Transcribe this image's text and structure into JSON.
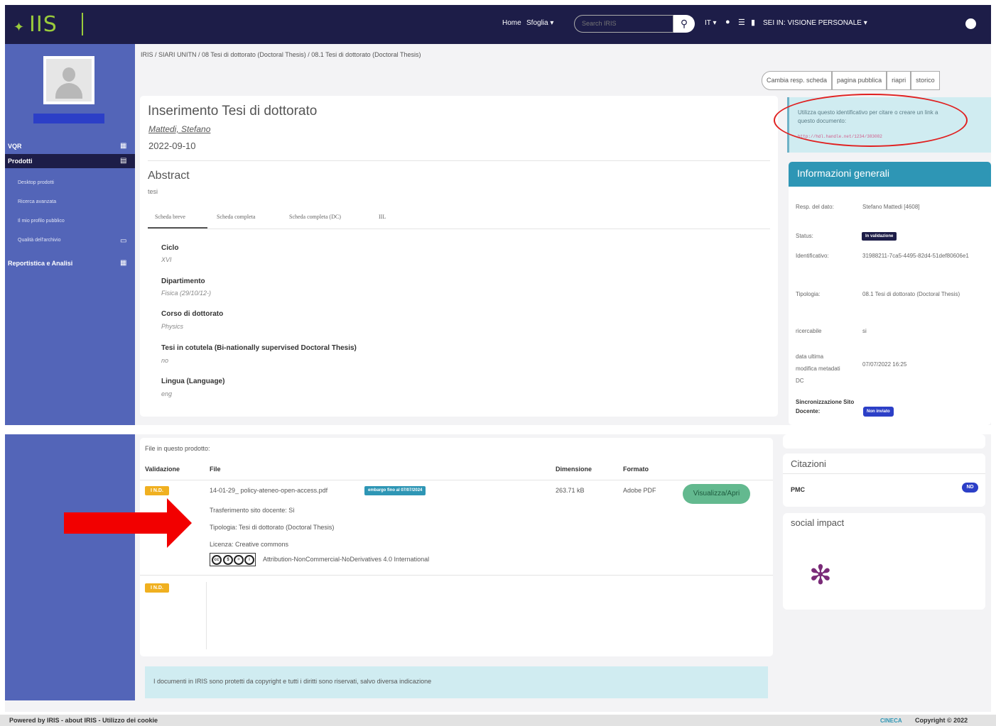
{
  "topbar": {
    "logo_text": "IIS",
    "nav_home": "Home",
    "nav_sfoglia": "Sfoglia ▾",
    "search_placeholder": "Search IRIS",
    "lang": "IT ▾",
    "profile_mode": "SEI IN: VISIONE PERSONALE ▾"
  },
  "sidebar": {
    "vqr": "VQR",
    "prodotti": "Prodotti",
    "sub_items": [
      "Desktop prodotti",
      "Ricerca avanzata",
      "Il mio profilo pubblico",
      "Qualità dell'archivio"
    ],
    "reportistica": "Reportistica e Analisi"
  },
  "breadcrumb": "IRIS / SIARI UNITN / 08 Tesi di dottorato (Doctoral Thesis) / 08.1 Tesi di dottorato (Doctoral Thesis)",
  "actions": [
    "Cambia resp. scheda",
    "pagina pubblica",
    "riapri",
    "storico"
  ],
  "record": {
    "title": "Inserimento Tesi di dottorato",
    "author": "Mattedi, Stefano",
    "date": "2022-09-10",
    "abstract_heading": "Abstract",
    "abstract_text": "tesi"
  },
  "tabs": [
    "Scheda breve",
    "Scheda completa",
    "Scheda completa (DC)",
    "IIL"
  ],
  "fields": [
    {
      "label": "Ciclo",
      "value": "XVI"
    },
    {
      "label": "Dipartimento",
      "value": "Fisica (29/10/12-)"
    },
    {
      "label": "Corso di dottorato",
      "value": "Physics"
    },
    {
      "label": "Tesi in cotutela (Bi-nationally supervised Doctoral Thesis)",
      "value": "no"
    },
    {
      "label": "Lingua (Language)",
      "value": "eng"
    }
  ],
  "handle": {
    "text": "Utilizza questo identificativo per citare o creare un link a questo documento:",
    "url": "http://hdl.handle.net/1234/383082"
  },
  "info": {
    "heading": "Informazioni generali",
    "resp_label": "Resp. del dato:",
    "resp_value": "Stefano Mattedi [4608]",
    "status_label": "Status:",
    "status_value": "In validazione",
    "id_label": "Identificativo:",
    "id_value": "31988211-7ca5-4495-82d4-51def80606e1",
    "tipologia_label": "Tipologia:",
    "tipologia_value": "08.1 Tesi di dottorato (Doctoral Thesis)",
    "ricercabile_label": "ricercabile",
    "ricercabile_value": "si",
    "data_label": "data ultima modifica metadati DC",
    "data_value": "07/07/2022 16:25",
    "sync_label": "Sincronizzazione Sito Docente:",
    "sync_value": "Non inviato"
  },
  "files": {
    "heading": "File in questo prodotto:",
    "columns": [
      "Validazione",
      "File",
      "Dimensione",
      "Formato"
    ],
    "row1": {
      "validation": "I N.D.",
      "file_name": "14-01-29_ policy-ateneo-open-access.pdf",
      "embargo": "embargo fino al 07/07/2024",
      "size": "263.71 kB",
      "format": "Adobe PDF",
      "button": "Visualizza/Apri",
      "trasferimento": "Trasferimento sito docente: Sì",
      "tipologia": "Tipologia: Tesi di dottorato (Doctoral Thesis)",
      "licenza": "Licenza: Creative commons",
      "license_name": "Attribution-NonCommercial-NoDerivatives 4.0 International"
    },
    "row2_validation": "I N.D."
  },
  "copyright_note": "I documenti in IRIS sono protetti da copyright e tutti i diritti sono riservati, salvo diversa indicazione",
  "citazioni": {
    "heading": "Citazioni",
    "pmc": "PMC",
    "nd": "ND"
  },
  "social": {
    "heading": "social impact"
  },
  "footer": {
    "left": "Powered by IRIS  -  about IRIS  -  Utilizzo dei cookie",
    "cineca": "CINECA",
    "copyright": "Copyright © 2022"
  },
  "colors": {
    "navbar": "#1d1d48",
    "sidebar": "#5365b8",
    "accent": "#2e96b5",
    "annotation_red": "#e02020"
  }
}
